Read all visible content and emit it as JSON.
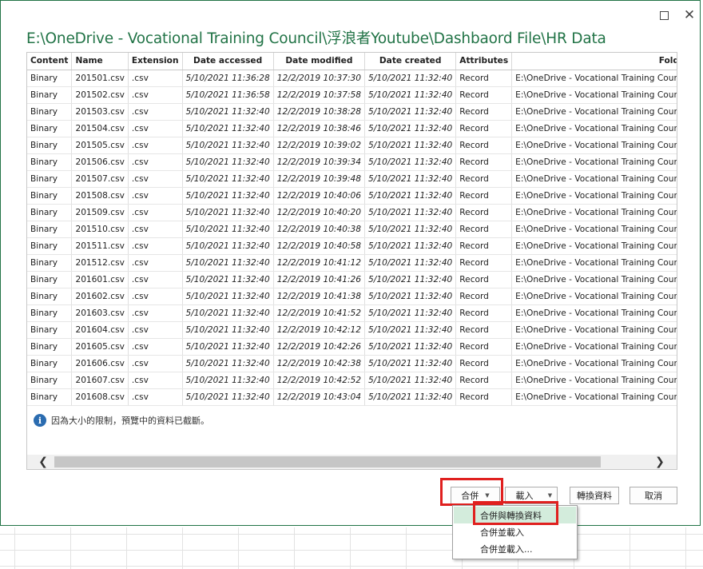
{
  "window": {
    "title": "E:\\OneDrive - Vocational Training Council\\浮浪者Youtube\\Dashbaord File\\HR Data"
  },
  "table": {
    "columns": [
      "Content",
      "Name",
      "Extension",
      "Date accessed",
      "Date modified",
      "Date created",
      "Attributes",
      "Folder Path"
    ],
    "folder_path": "E:\\OneDrive - Vocational Training Council\\浮浪者Youtube\\Dashbaord File\\HR Data\\",
    "rows": [
      [
        "Binary",
        "201501.csv",
        ".csv",
        "5/10/2021 11:36:28",
        "12/2/2019 10:37:30",
        "5/10/2021 11:32:40",
        "Record"
      ],
      [
        "Binary",
        "201502.csv",
        ".csv",
        "5/10/2021 11:36:58",
        "12/2/2019 10:37:58",
        "5/10/2021 11:32:40",
        "Record"
      ],
      [
        "Binary",
        "201503.csv",
        ".csv",
        "5/10/2021 11:32:40",
        "12/2/2019 10:38:28",
        "5/10/2021 11:32:40",
        "Record"
      ],
      [
        "Binary",
        "201504.csv",
        ".csv",
        "5/10/2021 11:32:40",
        "12/2/2019 10:38:46",
        "5/10/2021 11:32:40",
        "Record"
      ],
      [
        "Binary",
        "201505.csv",
        ".csv",
        "5/10/2021 11:32:40",
        "12/2/2019 10:39:02",
        "5/10/2021 11:32:40",
        "Record"
      ],
      [
        "Binary",
        "201506.csv",
        ".csv",
        "5/10/2021 11:32:40",
        "12/2/2019 10:39:34",
        "5/10/2021 11:32:40",
        "Record"
      ],
      [
        "Binary",
        "201507.csv",
        ".csv",
        "5/10/2021 11:32:40",
        "12/2/2019 10:39:48",
        "5/10/2021 11:32:40",
        "Record"
      ],
      [
        "Binary",
        "201508.csv",
        ".csv",
        "5/10/2021 11:32:40",
        "12/2/2019 10:40:06",
        "5/10/2021 11:32:40",
        "Record"
      ],
      [
        "Binary",
        "201509.csv",
        ".csv",
        "5/10/2021 11:32:40",
        "12/2/2019 10:40:20",
        "5/10/2021 11:32:40",
        "Record"
      ],
      [
        "Binary",
        "201510.csv",
        ".csv",
        "5/10/2021 11:32:40",
        "12/2/2019 10:40:38",
        "5/10/2021 11:32:40",
        "Record"
      ],
      [
        "Binary",
        "201511.csv",
        ".csv",
        "5/10/2021 11:32:40",
        "12/2/2019 10:40:58",
        "5/10/2021 11:32:40",
        "Record"
      ],
      [
        "Binary",
        "201512.csv",
        ".csv",
        "5/10/2021 11:32:40",
        "12/2/2019 10:41:12",
        "5/10/2021 11:32:40",
        "Record"
      ],
      [
        "Binary",
        "201601.csv",
        ".csv",
        "5/10/2021 11:32:40",
        "12/2/2019 10:41:26",
        "5/10/2021 11:32:40",
        "Record"
      ],
      [
        "Binary",
        "201602.csv",
        ".csv",
        "5/10/2021 11:32:40",
        "12/2/2019 10:41:38",
        "5/10/2021 11:32:40",
        "Record"
      ],
      [
        "Binary",
        "201603.csv",
        ".csv",
        "5/10/2021 11:32:40",
        "12/2/2019 10:41:52",
        "5/10/2021 11:32:40",
        "Record"
      ],
      [
        "Binary",
        "201604.csv",
        ".csv",
        "5/10/2021 11:32:40",
        "12/2/2019 10:42:12",
        "5/10/2021 11:32:40",
        "Record"
      ],
      [
        "Binary",
        "201605.csv",
        ".csv",
        "5/10/2021 11:32:40",
        "12/2/2019 10:42:26",
        "5/10/2021 11:32:40",
        "Record"
      ],
      [
        "Binary",
        "201606.csv",
        ".csv",
        "5/10/2021 11:32:40",
        "12/2/2019 10:42:38",
        "5/10/2021 11:32:40",
        "Record"
      ],
      [
        "Binary",
        "201607.csv",
        ".csv",
        "5/10/2021 11:32:40",
        "12/2/2019 10:42:52",
        "5/10/2021 11:32:40",
        "Record"
      ],
      [
        "Binary",
        "201608.csv",
        ".csv",
        "5/10/2021 11:32:40",
        "12/2/2019 10:43:04",
        "5/10/2021 11:32:40",
        "Record"
      ]
    ]
  },
  "info": {
    "message": "因為大小的限制，預覽中的資料已截斷。"
  },
  "buttons": {
    "combine": "合併",
    "load": "載入",
    "transform": "轉換資料",
    "cancel": "取消"
  },
  "combine_menu": {
    "items": [
      "合併與轉換資料",
      "合併並載入",
      "合併並載入..."
    ]
  },
  "icons": {
    "info": "info-icon",
    "close": "close-icon",
    "maximize": "maximize-icon",
    "scroll_left": "chevron-left-icon",
    "scroll_right": "chevron-right-icon",
    "dropdown": "caret-down-icon"
  },
  "colors": {
    "accent": "#217346",
    "highlight_box": "#e0201f",
    "menu_hover": "#d3ecdc"
  }
}
